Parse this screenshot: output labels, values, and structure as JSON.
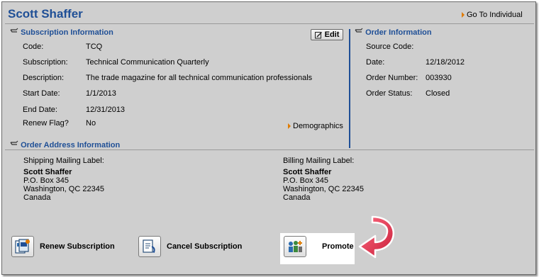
{
  "header": {
    "name": "Scott Shaffer",
    "go_to_individual": "Go To Individual"
  },
  "subscription": {
    "section_title": "Subscription Information",
    "edit_label": "Edit",
    "fields": [
      {
        "label": "Code:",
        "value": "TCQ"
      },
      {
        "label": "Subscription:",
        "value": "Technical Communication Quarterly"
      },
      {
        "label": "Description:",
        "value": "The trade magazine for all technical communication professionals"
      },
      {
        "label": "Start Date:",
        "value": "1/1/2013"
      },
      {
        "label": "End Date:",
        "value": "12/31/2013"
      },
      {
        "label": "Renew Flag?",
        "value": "No"
      }
    ],
    "demographics_label": "Demographics"
  },
  "order": {
    "section_title": "Order Information",
    "fields": [
      {
        "label": "Source Code:",
        "value": ""
      },
      {
        "label": "Date:",
        "value": "12/18/2012"
      },
      {
        "label": "Order Number:",
        "value": "003930"
      },
      {
        "label": "Order Status:",
        "value": "Closed"
      }
    ]
  },
  "address": {
    "section_title": "Order Address Information",
    "shipping": {
      "label": "Shipping Mailing Label:",
      "name": "Scott Shaffer",
      "line1": "P.O. Box 345",
      "line2": "Washington, QC 22345",
      "line3": "Canada"
    },
    "billing": {
      "label": "Billing Mailing Label:",
      "name": "Scott Shaffer",
      "line1": "P.O. Box 345",
      "line2": "Washington, QC 22345",
      "line3": "Canada"
    }
  },
  "actions": {
    "renew": "Renew Subscription",
    "cancel": "Cancel Subscription",
    "promote": "Promote"
  },
  "colors": {
    "heading_blue": "#1f4f96",
    "panel_gray": "#cfcfcf",
    "callout_red": "#e0304a",
    "link_arrow_orange": "#e07b00"
  }
}
